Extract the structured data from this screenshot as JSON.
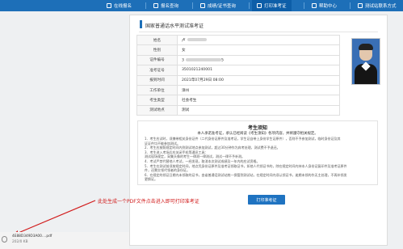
{
  "nav": {
    "items": [
      {
        "label": "在线报名",
        "icon": "monitor-icon"
      },
      {
        "label": "报名查询",
        "icon": "search-icon"
      },
      {
        "label": "成绩/证书查询",
        "icon": "certificate-icon"
      },
      {
        "label": "打印准考证",
        "icon": "print-icon"
      },
      {
        "label": "帮助中心",
        "icon": "help-icon"
      },
      {
        "label": "测试站联系方式",
        "icon": "contact-icon"
      }
    ],
    "active_index": 3,
    "bg_color": "#1d6fb8"
  },
  "page_title": "国家普通话水平测试准考证",
  "info": {
    "rows": [
      {
        "label": "姓名",
        "value": "卢"
      },
      {
        "label": "性别",
        "value": "女"
      },
      {
        "label": "证件编号",
        "value": "3"
      },
      {
        "label": "准考证号",
        "value": "3501021240001"
      },
      {
        "label": "报到时间",
        "value": "2021年07月29日 08:00"
      },
      {
        "label": "工作单位",
        "value": "漳州"
      },
      {
        "label": "考生类型",
        "value": "社会考生"
      },
      {
        "label": "测试地点",
        "value": "测试"
      }
    ],
    "id_suffix": "5"
  },
  "notice": {
    "title": "考生须知",
    "subtitle": "本人承诺准考证，承认已经阅读《考生须知》各项内容，并将遵守相关规定。",
    "lines": [
      "1．考生应试时，须携带相关身份证件（二代身份证原件及准考证，学生证自带上身份学生证原件），否则不予参加测试，临时身份证及其",
      "证证件均不能参加测试。",
      "2．考生应按照规定时间内到测试地点参加测试，超过30分钟作为弃考处理，测试费不予退还。",
      "3．考生进入考场后应关闭手机等通讯工具：",
      "测试现场规定，采集头像的考生一律测一律测试，测试一律不予补测。",
      "4．考试严禁代替他人考试，一经发现，取消本次测试成绩及一年内的应试资格。",
      "5．考生在测试前须按规定时间，地点凭身份证原件及准考证领取证书，如他人代领证书的，除在规定时间内持本人身份证复印件及准考证原件",
      "件，还需交领代领者的身份证。",
      "6．在规定的领证日期内未领取的证书，由省普通话测试站统一保管到测试站，在规定时间内须认领证书，逾期未领的作无主处理，不再补领发",
      "更换证。"
    ]
  },
  "print_button": "打印准考证",
  "annotation": "此处生成一个PDF文件点击进入即可打印准考证",
  "download": {
    "filename": "4E88D349D3A00....pdf",
    "size": "202/0 KB"
  }
}
